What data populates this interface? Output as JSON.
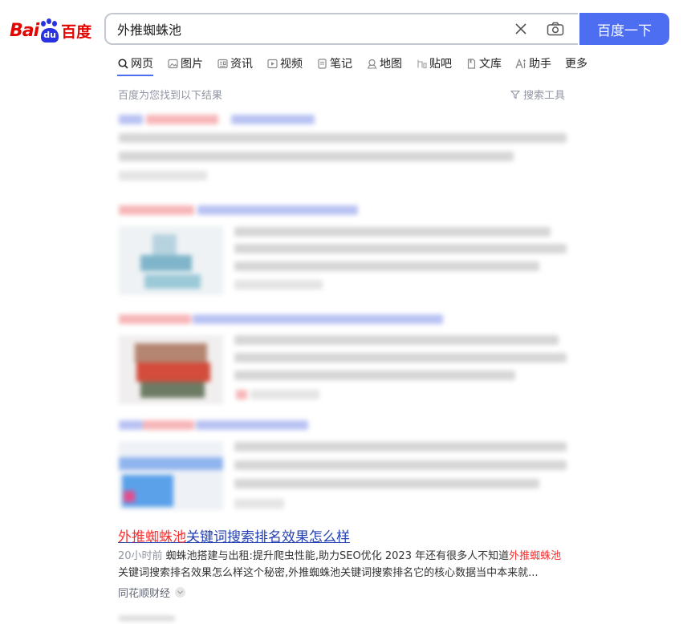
{
  "logo": {
    "latin": "Bai",
    "paw_text": "du",
    "chinese": "百度"
  },
  "search": {
    "query": "外推蜘蛛池",
    "button_label": "百度一下"
  },
  "tabs": [
    {
      "label": "网页",
      "icon": "search-icon"
    },
    {
      "label": "图片",
      "icon": "image-icon"
    },
    {
      "label": "资讯",
      "icon": "news-icon"
    },
    {
      "label": "视频",
      "icon": "video-icon"
    },
    {
      "label": "笔记",
      "icon": "note-icon"
    },
    {
      "label": "地图",
      "icon": "map-icon"
    },
    {
      "label": "贴吧",
      "icon": "tieba-icon"
    },
    {
      "label": "文库",
      "icon": "doc-icon"
    },
    {
      "label": "助手",
      "icon": "ai-icon"
    },
    {
      "label": "更多",
      "icon": ""
    }
  ],
  "results_meta": {
    "found_text": "百度为您找到以下结果",
    "tools_label": "搜索工具"
  },
  "result": {
    "title_highlight": "外推蜘蛛池",
    "title_rest": "关键词搜索排名效果怎么样",
    "time": "20小时前",
    "snippet_a": "蜘蛛池搭建与出租:提升爬虫性能,助力SEO优化 2023 年还有很多人不知道",
    "snippet_highlight": "外推蜘蛛池",
    "snippet_b": "关键词搜索排名效果怎么样这个秘密,外推蜘蛛池关键词搜索排名它的核心数据当中本来就...",
    "source": "同花顺财经"
  },
  "colors": {
    "accent": "#4e6ef2",
    "logo_red": "#e10602",
    "logo_blue": "#2932e1",
    "link": "#2440b3",
    "highlight": "#f73131"
  }
}
